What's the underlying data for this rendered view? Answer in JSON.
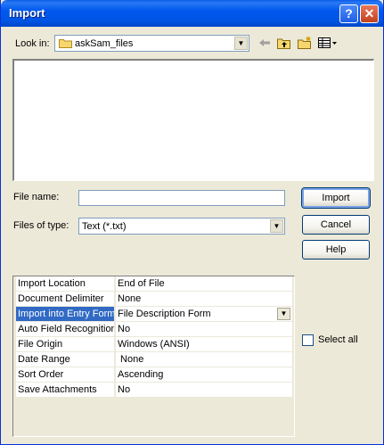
{
  "window": {
    "title": "Import",
    "help_glyph": "?",
    "close_glyph": "✕"
  },
  "look_in": {
    "label": "Look in:",
    "value": "askSam_files",
    "icon": "folder-icon"
  },
  "toolbar": {
    "icons": [
      "back-arrow-icon",
      "up-folder-icon",
      "new-folder-icon",
      "view-menu-icon"
    ]
  },
  "file_name": {
    "label": "File name:",
    "value": ""
  },
  "files_of_type": {
    "label": "Files of type:",
    "value": "Text (*.txt)"
  },
  "buttons": {
    "import": "Import",
    "cancel": "Cancel",
    "help": "Help"
  },
  "properties": [
    {
      "key": "Import Location",
      "value": "End of File"
    },
    {
      "key": "Document Delimiter",
      "value": "None"
    },
    {
      "key": "Import into Entry Form",
      "value": "File Description Form"
    },
    {
      "key": "Auto Field Recognition",
      "value": "No"
    },
    {
      "key": "File Origin",
      "value": "Windows (ANSI)"
    },
    {
      "key": "Date Range",
      "value": " None"
    },
    {
      "key": "Sort Order",
      "value": "Ascending"
    },
    {
      "key": "Save Attachments",
      "value": "No"
    }
  ],
  "select_all": {
    "label": "Select all",
    "checked": false
  },
  "colors": {
    "titlebar": "#0054e3",
    "selection": "#316ac5",
    "dialog_bg": "#ece9d8"
  }
}
